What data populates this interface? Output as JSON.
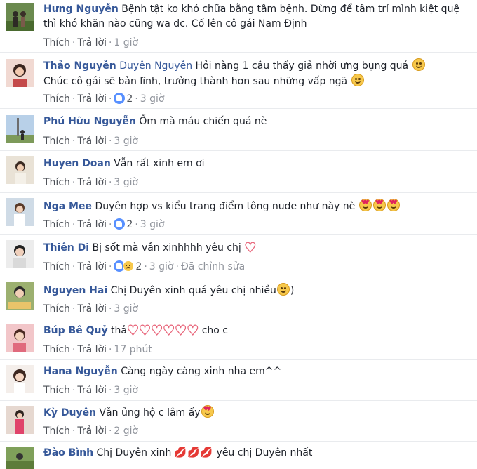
{
  "comments": [
    {
      "author": "Hưng Nguyễn",
      "tag": "",
      "text": "Bệnh tật ko khó chữa bằng tâm bệnh. Đừng để tâm trí mình kiệt quệ thì khó khăn nào cũng wa đc. Cố lên cô gái Nam Định",
      "text_after": "",
      "like_label": "Thích",
      "reply_label": "Trả lời",
      "reactions": "",
      "time": "1 giờ",
      "edited": ""
    },
    {
      "author": "Thảo Nguyễn",
      "tag": "Duyên Nguyễn",
      "text": "Hỏi nàng 1 câu thấy giả nhời ưng bụng quá",
      "text_line2": "Chúc cô gái sẽ bản lĩnh, trưởng thành hơn sau những vấp ngã",
      "like_label": "Thích",
      "reply_label": "Trả lời",
      "reactions": "2",
      "time": "3 giờ",
      "edited": ""
    },
    {
      "author": "Phú Hữu Nguyễn",
      "tag": "",
      "text": "Ốm mà máu chiến quá nè",
      "like_label": "Thích",
      "reply_label": "Trả lời",
      "reactions": "",
      "time": "3 giờ",
      "edited": ""
    },
    {
      "author": "Huyen Doan",
      "tag": "",
      "text": "Vẫn rất xinh em ơi",
      "like_label": "Thích",
      "reply_label": "Trả lời",
      "reactions": "",
      "time": "3 giờ",
      "edited": ""
    },
    {
      "author": "Nga Mee",
      "tag": "",
      "text": "Duyên hợp vs kiểu trang điểm tông nude như này nè",
      "like_label": "Thích",
      "reply_label": "Trả lời",
      "reactions": "2",
      "time": "3 giờ",
      "edited": ""
    },
    {
      "author": "Thiên Di",
      "tag": "",
      "text": "Bị sốt mà vẫn xinhhhh yêu chị",
      "like_label": "Thích",
      "reply_label": "Trả lời",
      "reactions": "2",
      "time": "3 giờ",
      "edited": "Đã chỉnh sửa"
    },
    {
      "author": "Nguyen Hai",
      "tag": "",
      "text": "Chị Duyên xinh quá yêu chị nhiều",
      "text_after": ")",
      "like_label": "Thích",
      "reply_label": "Trả lời",
      "reactions": "",
      "time": "3 giờ",
      "edited": ""
    },
    {
      "author": "Búp Bê Quỷ",
      "tag": "",
      "text": "thả",
      "text_after": "cho c",
      "like_label": "Thích",
      "reply_label": "Trả lời",
      "reactions": "",
      "time": "17 phút",
      "edited": ""
    },
    {
      "author": "Hana Nguyễn",
      "tag": "",
      "text": "Càng ngày càng xinh nha em^^",
      "like_label": "Thích",
      "reply_label": "Trả lời",
      "reactions": "",
      "time": "3 giờ",
      "edited": ""
    },
    {
      "author": "Kỳ Duyên",
      "tag": "",
      "text": "Vẫn ủng hộ c lắm ấy",
      "like_label": "Thích",
      "reply_label": "Trả lời",
      "reactions": "",
      "time": "2 giờ",
      "edited": ""
    },
    {
      "author": "Đào Bình",
      "tag": "",
      "text": "Chị Duyên xinh",
      "text_after": "yêu chị Duyên nhất",
      "like_label": "",
      "reply_label": "",
      "reactions": "",
      "time": "",
      "edited": ""
    }
  ],
  "colors": {
    "name": "#365899",
    "text": "#1d2129",
    "meta": "#90949c",
    "like_blue": "#5890ff",
    "heart": "#e8657a"
  },
  "icons": [
    "smile-emoji-icon",
    "heart-eyes-emoji-icon",
    "heart-icon",
    "like-reaction-icon",
    "sad-reaction-icon",
    "lips-icon"
  ]
}
